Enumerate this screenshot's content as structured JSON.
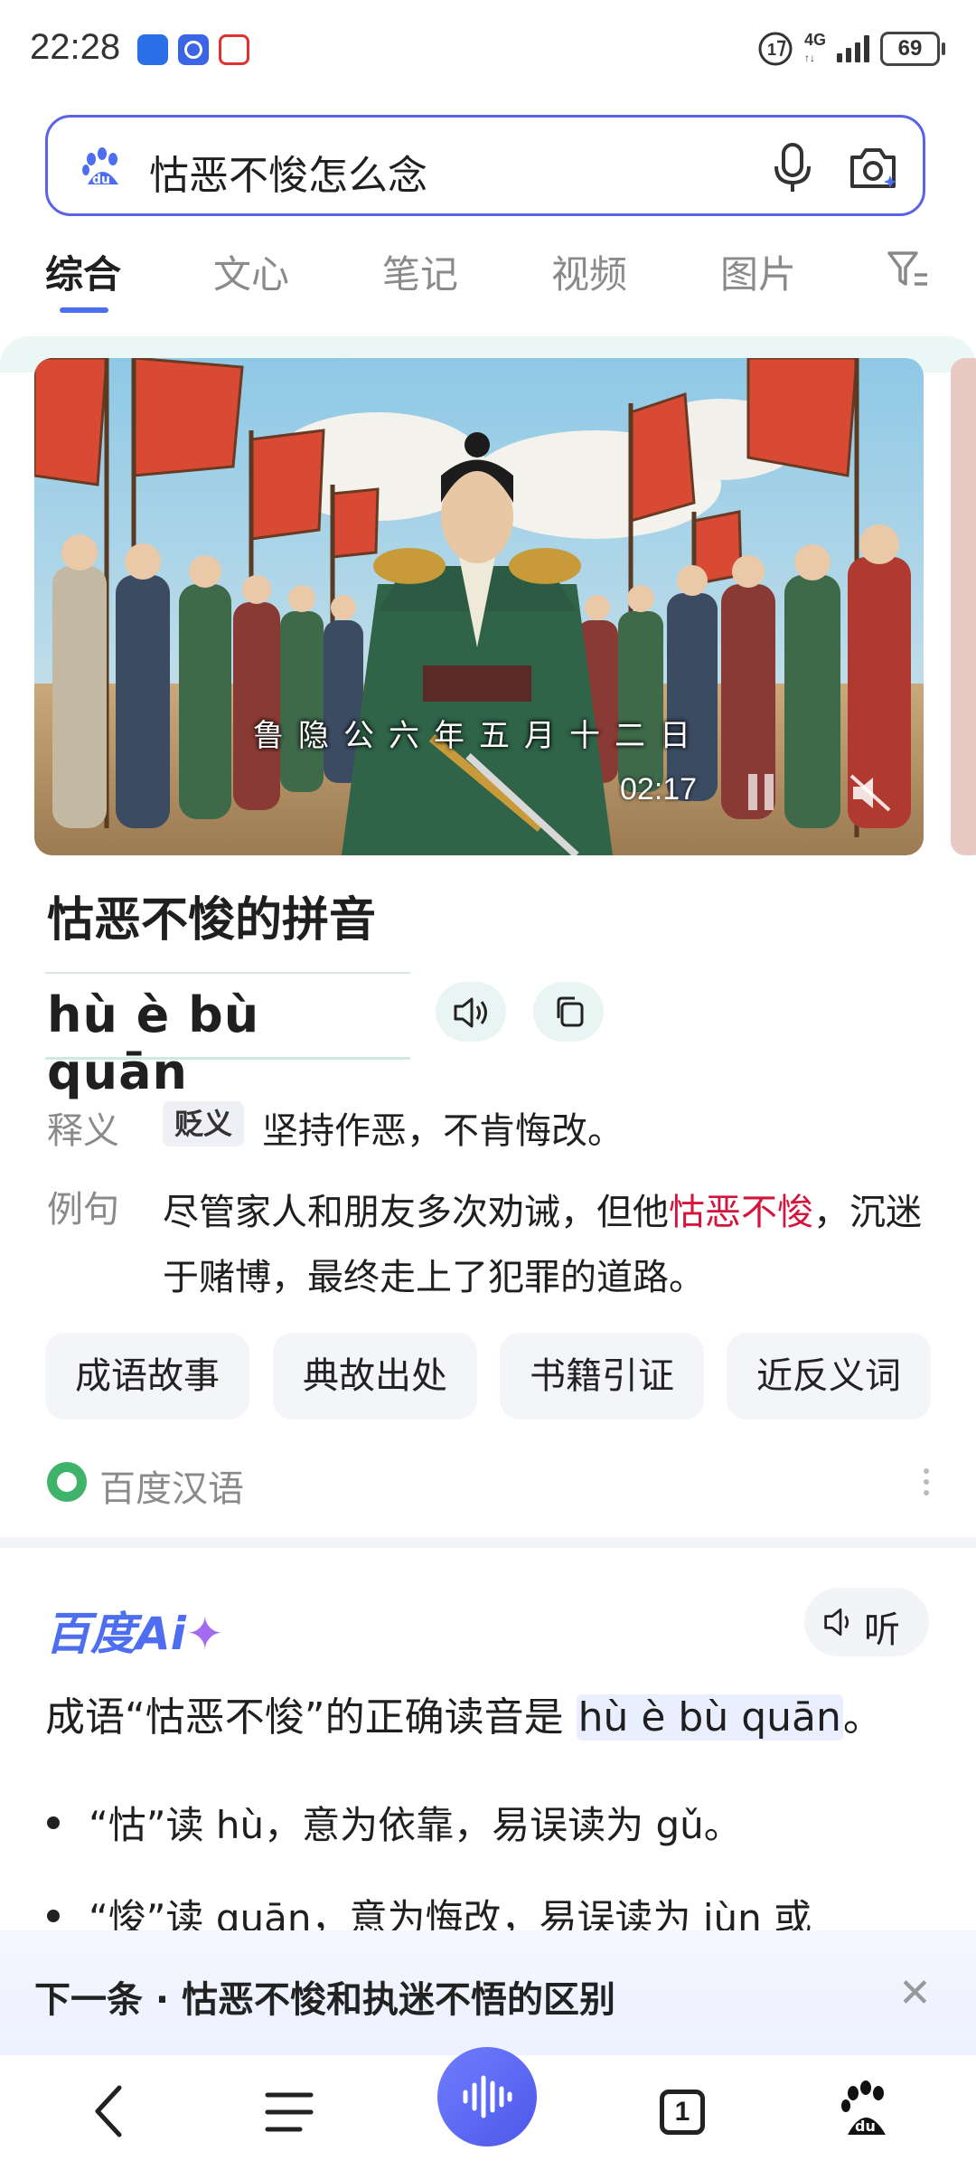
{
  "status_bar": {
    "time": "22:28",
    "network": "4G",
    "battery": "69",
    "app_icons": [
      "12123-app-icon",
      "baidu-app-icon",
      "yolo-app-icon"
    ]
  },
  "search": {
    "query": "怙恶不悛怎么念"
  },
  "tabs": [
    "综合",
    "文心",
    "笔记",
    "视频",
    "图片"
  ],
  "active_tab": 0,
  "video": {
    "subtitle": "鲁隐公六年五月十二日",
    "duration": "02:17"
  },
  "idiom": {
    "heading": "怙恶不悛的拼音",
    "pinyin": "hù è bù quān",
    "definition_label": "释义",
    "definition_badge": "贬义",
    "definition": "坚持作恶，不肯悔改。",
    "example_label": "例句",
    "example_before": "尽管家人和朋友多次劝诫，但他",
    "example_highlight": "怙恶不悛",
    "example_after": "，沉迷于赌博，最终走上了犯罪的道路。",
    "chips": [
      "成语故事",
      "典故出处",
      "书籍引证",
      "近反义词"
    ],
    "source": "百度汉语"
  },
  "ai": {
    "logo": "百度Ai",
    "listen": "听",
    "answer_before": "成语“怙恶不悛”的正确读音是 ",
    "answer_pinyin": "hù è bù quān",
    "answer_after": "。",
    "bullets": [
      "“怙”读 hù，意为依靠，易误读为 gǔ。",
      "“悛”读 quān，意为悔改，易误读为 jùn 或"
    ]
  },
  "next": {
    "text": "下一条 · 怙恶不悛和执迷不悟的区别"
  },
  "bottom_nav": {
    "tab_count": "1"
  },
  "colors": {
    "accent": "#4e6ef2",
    "highlight": "#d4143c",
    "teal_tint": "#e8f5f2"
  }
}
